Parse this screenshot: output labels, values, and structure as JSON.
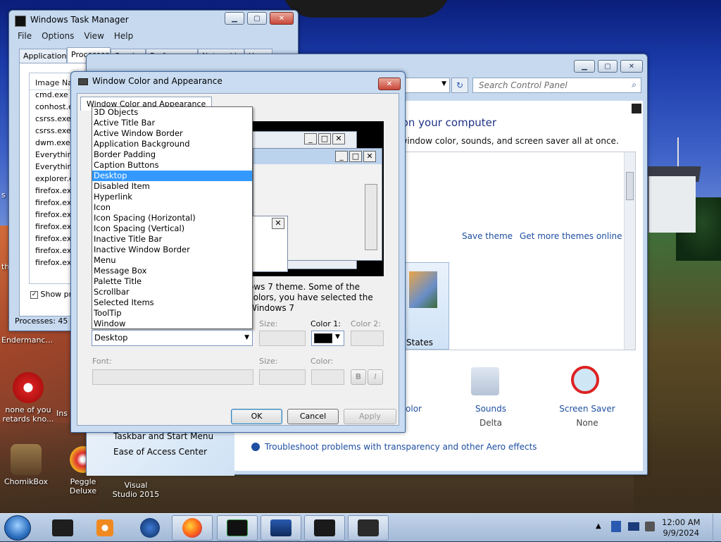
{
  "task_manager": {
    "title": "Windows Task Manager",
    "menu": [
      "File",
      "Options",
      "View",
      "Help"
    ],
    "tabs": [
      "Applications",
      "Processes",
      "Services",
      "Performance",
      "Networking",
      "Users"
    ],
    "column_header": "Image Name",
    "processes": [
      "cmd.exe",
      "conhost.exe",
      "csrss.exe",
      "csrss.exe",
      "dwm.exe",
      "Everything.exe",
      "Everything.exe",
      "explorer.exe",
      "firefox.exe",
      "firefox.exe",
      "firefox.exe",
      "firefox.exe",
      "firefox.exe",
      "firefox.exe",
      "firefox.exe"
    ],
    "show_processes_label": "Show processes from all users",
    "status": "Processes: 45"
  },
  "control_panel": {
    "search_placeholder": "Search Control Panel",
    "heading": "Change the visuals and sounds on your computer",
    "subheading": "Change the desktop background, window color, sounds, and screen saver all at once.",
    "save_theme": "Save theme",
    "get_more_themes": "Get more themes online",
    "theme_states": "States",
    "sounds_label": "Sounds",
    "sounds_value": "Delta",
    "screensaver_label": "Screen Saver",
    "screensaver_value": "None",
    "color_label": "Color",
    "troubleshoot": "Troubleshoot problems with transparency and other Aero effects",
    "side_links": [
      "Taskbar and Start Menu",
      "Ease of Access Center"
    ]
  },
  "dialog": {
    "title": "Window Color and Appearance",
    "tab": "Window Color and Appearance",
    "description": "ows 7 theme.  Some of the colors, you have selected the Windows 7",
    "item_options": [
      "3D Objects",
      "Active Title Bar",
      "Active Window Border",
      "Application Background",
      "Border Padding",
      "Caption Buttons",
      "Desktop",
      "Disabled Item",
      "Hyperlink",
      "Icon",
      "Icon Spacing (Horizontal)",
      "Icon Spacing (Vertical)",
      "Inactive Title Bar",
      "Inactive Window Border",
      "Menu",
      "Message Box",
      "Palette Title",
      "Scrollbar",
      "Selected Items",
      "ToolTip",
      "Window"
    ],
    "selected_item": "Desktop",
    "size_label": "Size:",
    "color1_label": "Color 1:",
    "color2_label": "Color 2:",
    "font_label": "Font:",
    "font_size_label": "Size:",
    "font_color_label": "Color:",
    "bold": "B",
    "italic": "I",
    "ok": "OK",
    "cancel": "Cancel",
    "apply": "Apply",
    "color1_value": "#000000"
  },
  "desktop_icons": {
    "partial_left_1": "Endermanc...",
    "partial_left_2": "none of you retards kno...",
    "partial_left_3": "Ins",
    "chomikbox": "ChomikBox",
    "peggle": "Peggle Deluxe",
    "visual_studio": "Visual Studio 2015",
    "edge_left_1": "s",
    "edge_left_2": "th"
  },
  "clock": {
    "time": "12:00 AM",
    "date": "9/9/2024"
  },
  "colors": {
    "selection": "#3399ff",
    "link": "#1e4fa0",
    "heading": "#1e3287"
  }
}
